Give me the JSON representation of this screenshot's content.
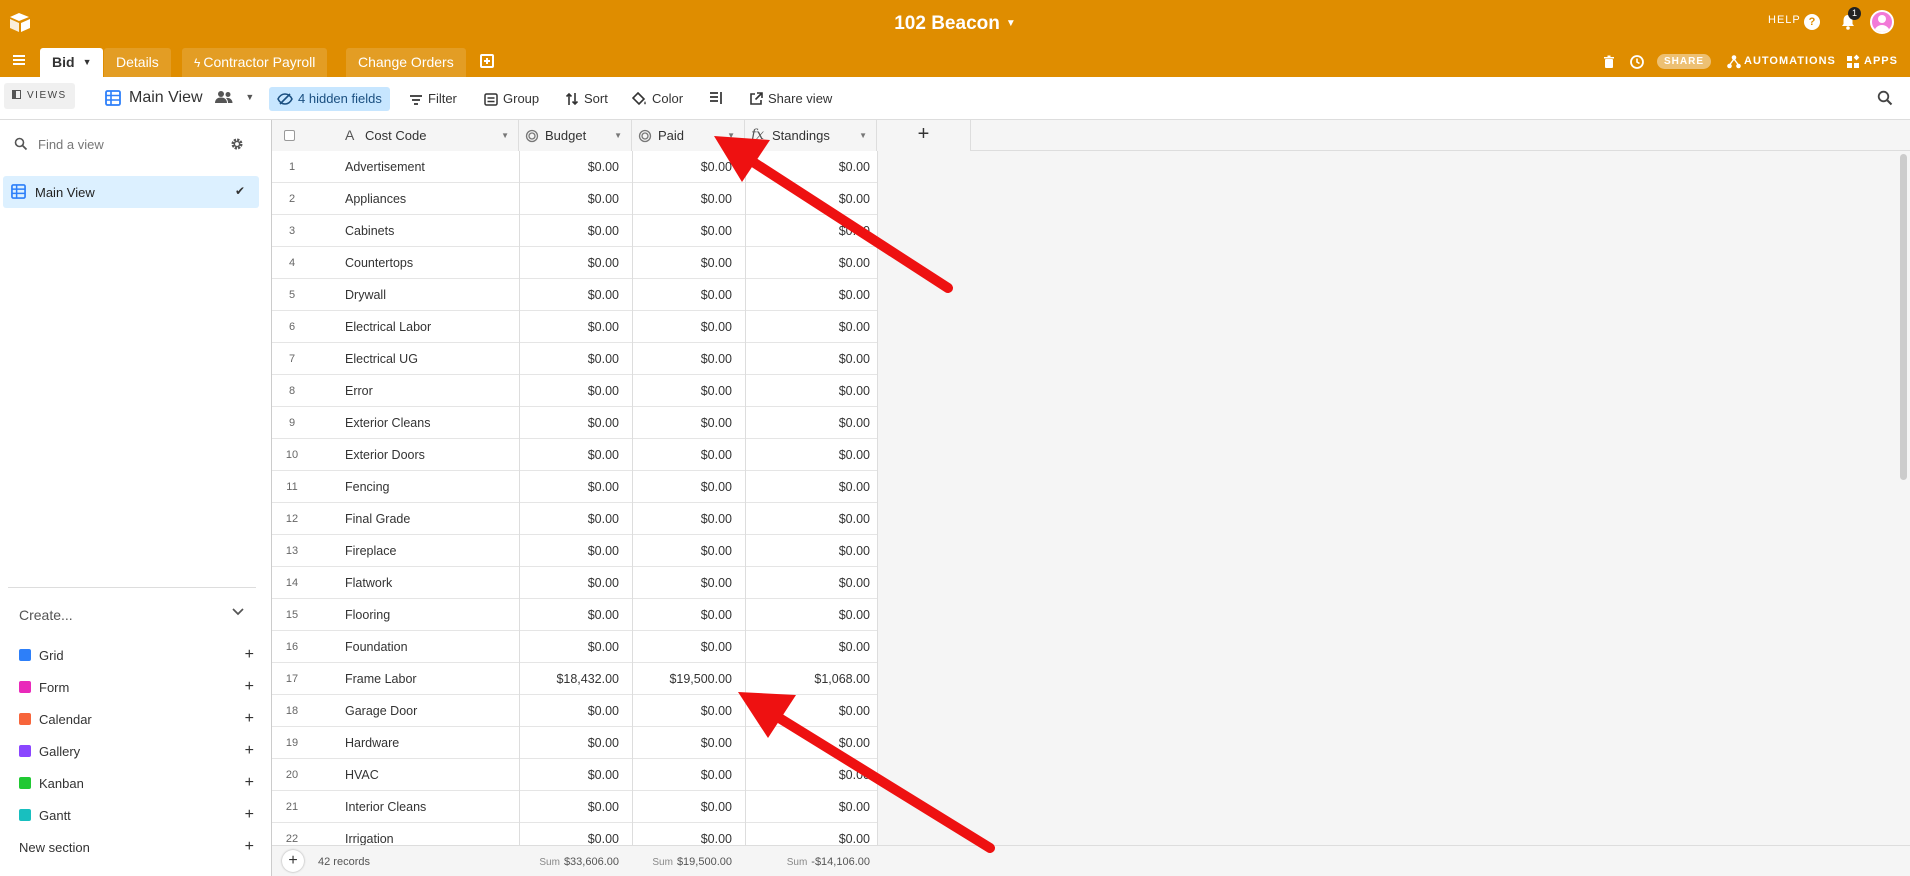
{
  "topbar": {
    "base_title": "102 Beacon",
    "help_label": "HELP",
    "help_icon": "?",
    "notification_count": "1",
    "tabs": [
      {
        "label": "Bid",
        "active": true
      },
      {
        "label": "Details"
      },
      {
        "label": "Contractor Payroll"
      },
      {
        "label": "Change Orders"
      }
    ],
    "share_label": "SHARE",
    "automations_label": "AUTOMATIONS",
    "apps_label": "APPS"
  },
  "viewbar": {
    "views_label": "VIEWS",
    "view_name": "Main View",
    "hidden_fields": "4 hidden fields",
    "filter": "Filter",
    "group": "Group",
    "sort": "Sort",
    "color": "Color",
    "share_view": "Share view"
  },
  "sidebar": {
    "find_placeholder": "Find a view",
    "views": [
      {
        "label": "Main View"
      }
    ],
    "create_label": "Create...",
    "create_items": [
      {
        "label": "Grid",
        "color": "#2d7ff9"
      },
      {
        "label": "Form",
        "color": "#e929ba"
      },
      {
        "label": "Calendar",
        "color": "#f7653b"
      },
      {
        "label": "Gallery",
        "color": "#8b46ff"
      },
      {
        "label": "Kanban",
        "color": "#20c933"
      },
      {
        "label": "Gantt",
        "color": "#18bfbf"
      }
    ],
    "new_section": "New section"
  },
  "grid": {
    "columns": [
      "Cost Code",
      "Budget",
      "Paid",
      "Standings"
    ],
    "rows": [
      {
        "n": "1",
        "cost_code": "Advertisement",
        "budget": "$0.00",
        "paid": "$0.00",
        "standings": "$0.00"
      },
      {
        "n": "2",
        "cost_code": "Appliances",
        "budget": "$0.00",
        "paid": "$0.00",
        "standings": "$0.00"
      },
      {
        "n": "3",
        "cost_code": "Cabinets",
        "budget": "$0.00",
        "paid": "$0.00",
        "standings": "$0.00"
      },
      {
        "n": "4",
        "cost_code": "Countertops",
        "budget": "$0.00",
        "paid": "$0.00",
        "standings": "$0.00"
      },
      {
        "n": "5",
        "cost_code": "Drywall",
        "budget": "$0.00",
        "paid": "$0.00",
        "standings": "$0.00"
      },
      {
        "n": "6",
        "cost_code": "Electrical Labor",
        "budget": "$0.00",
        "paid": "$0.00",
        "standings": "$0.00"
      },
      {
        "n": "7",
        "cost_code": "Electrical UG",
        "budget": "$0.00",
        "paid": "$0.00",
        "standings": "$0.00"
      },
      {
        "n": "8",
        "cost_code": "Error",
        "budget": "$0.00",
        "paid": "$0.00",
        "standings": "$0.00"
      },
      {
        "n": "9",
        "cost_code": "Exterior Cleans",
        "budget": "$0.00",
        "paid": "$0.00",
        "standings": "$0.00"
      },
      {
        "n": "10",
        "cost_code": "Exterior Doors",
        "budget": "$0.00",
        "paid": "$0.00",
        "standings": "$0.00"
      },
      {
        "n": "11",
        "cost_code": "Fencing",
        "budget": "$0.00",
        "paid": "$0.00",
        "standings": "$0.00"
      },
      {
        "n": "12",
        "cost_code": "Final Grade",
        "budget": "$0.00",
        "paid": "$0.00",
        "standings": "$0.00"
      },
      {
        "n": "13",
        "cost_code": "Fireplace",
        "budget": "$0.00",
        "paid": "$0.00",
        "standings": "$0.00"
      },
      {
        "n": "14",
        "cost_code": "Flatwork",
        "budget": "$0.00",
        "paid": "$0.00",
        "standings": "$0.00"
      },
      {
        "n": "15",
        "cost_code": "Flooring",
        "budget": "$0.00",
        "paid": "$0.00",
        "standings": "$0.00"
      },
      {
        "n": "16",
        "cost_code": "Foundation",
        "budget": "$0.00",
        "paid": "$0.00",
        "standings": "$0.00"
      },
      {
        "n": "17",
        "cost_code": "Frame Labor",
        "budget": "$18,432.00",
        "paid": "$19,500.00",
        "standings": "$1,068.00"
      },
      {
        "n": "18",
        "cost_code": "Garage Door",
        "budget": "$0.00",
        "paid": "$0.00",
        "standings": "$0.00"
      },
      {
        "n": "19",
        "cost_code": "Hardware",
        "budget": "$0.00",
        "paid": "$0.00",
        "standings": "$0.00"
      },
      {
        "n": "20",
        "cost_code": "HVAC",
        "budget": "$0.00",
        "paid": "$0.00",
        "standings": "$0.00"
      },
      {
        "n": "21",
        "cost_code": "Interior Cleans",
        "budget": "$0.00",
        "paid": "$0.00",
        "standings": "$0.00"
      },
      {
        "n": "22",
        "cost_code": "Irrigation",
        "budget": "$0.00",
        "paid": "$0.00",
        "standings": "$0.00"
      }
    ],
    "footer": {
      "record_count": "42 records",
      "sum_label": "Sum",
      "budget_sum": "$33,606.00",
      "paid_sum": "$19,500.00",
      "standings_sum": "-$14,106.00"
    }
  },
  "colors": {
    "header_bg": "#df8d00",
    "selected_view_bg": "#dcf0ff",
    "hidden_fields_bg": "#c7e6ff",
    "annotation_arrow": "#ee1111"
  }
}
